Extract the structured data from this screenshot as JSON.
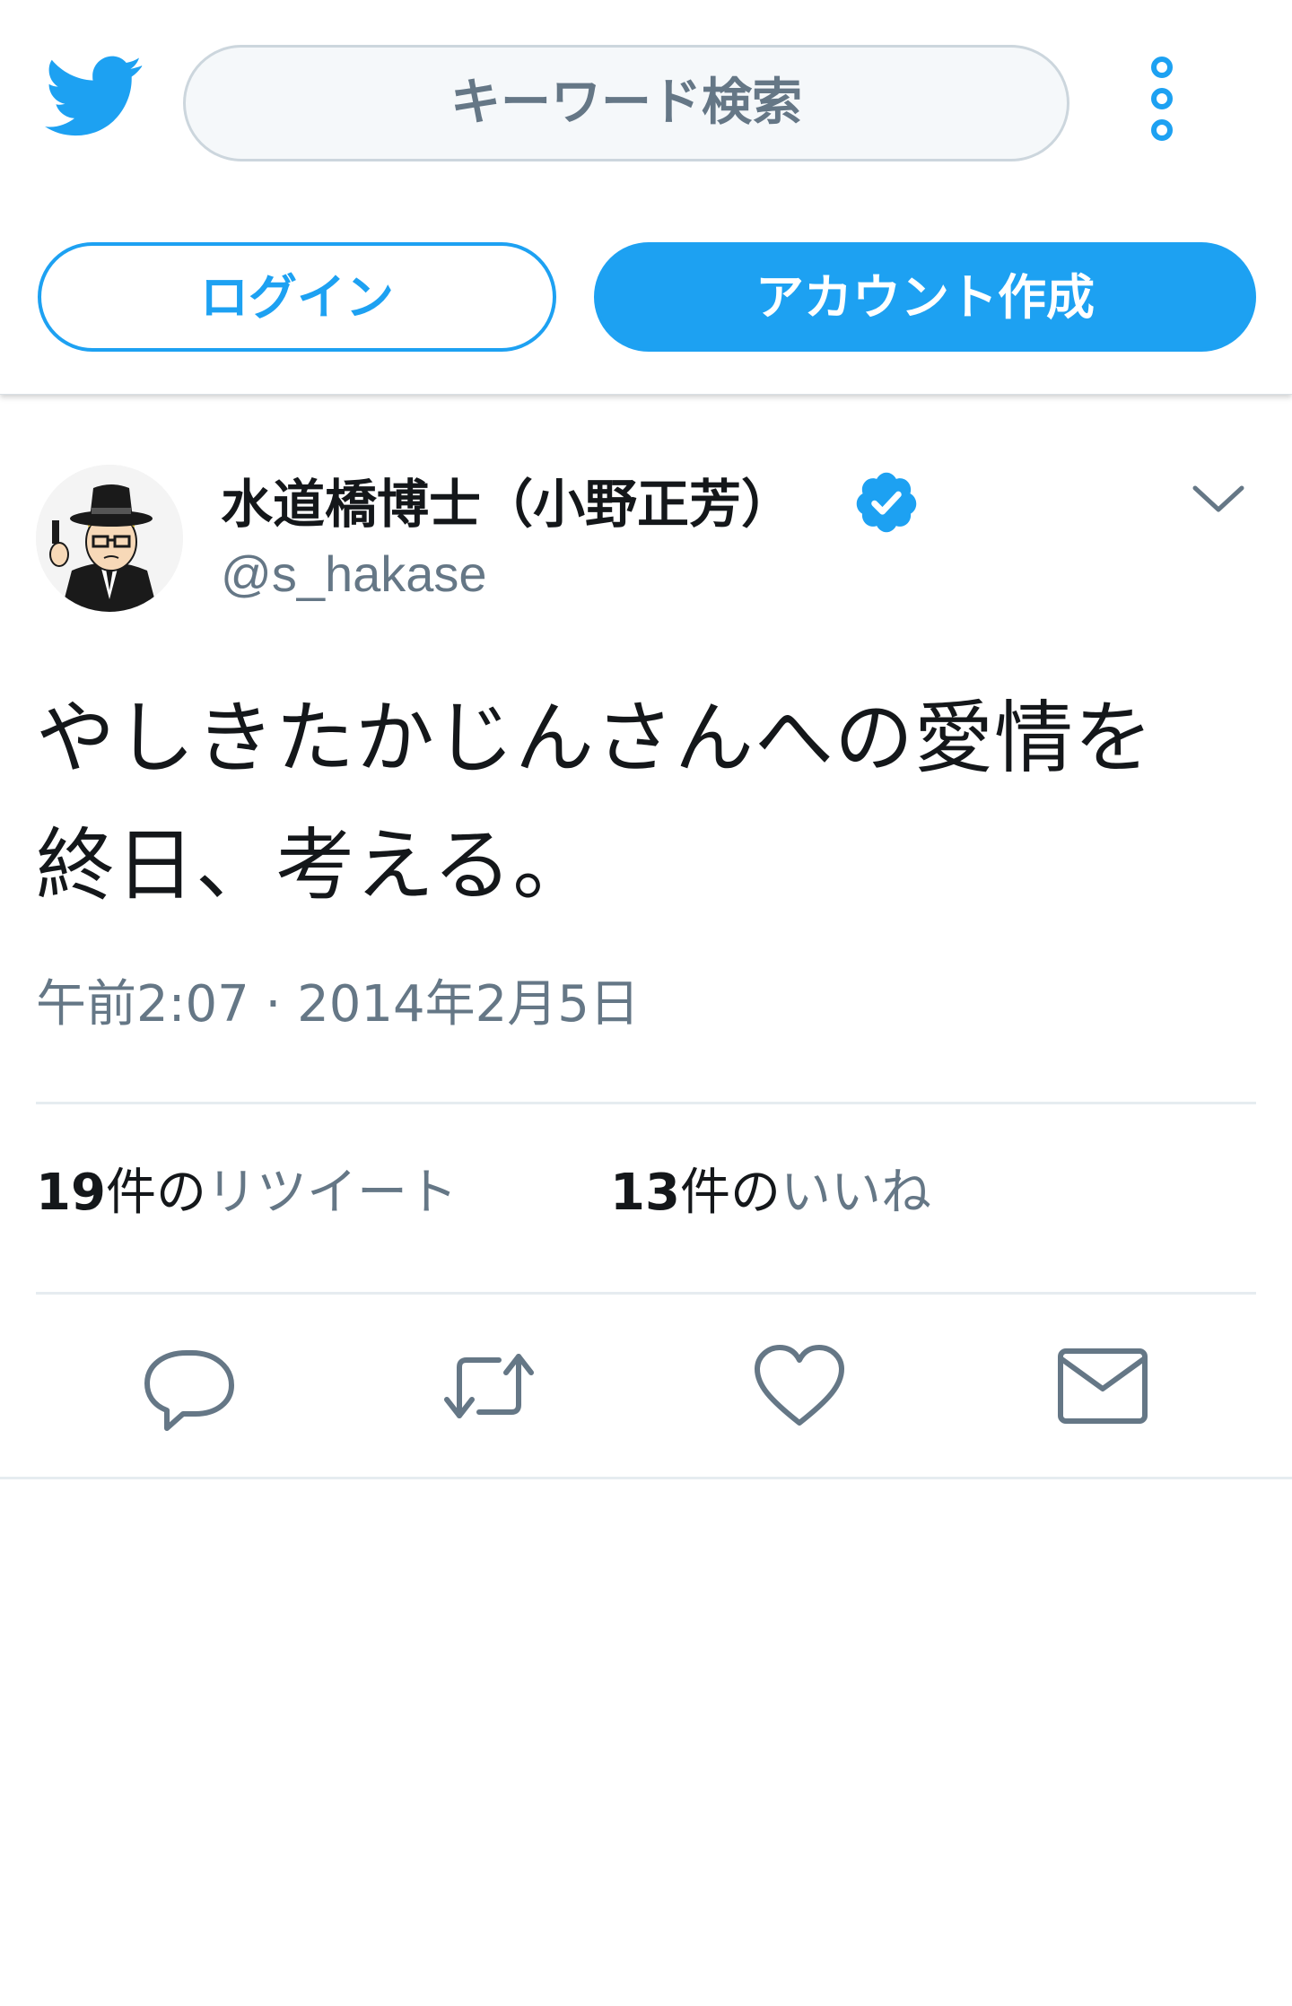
{
  "header": {
    "search_placeholder": "キーワード検索",
    "login_label": "ログイン",
    "signup_label": "アカウント作成"
  },
  "tweet": {
    "display_name": "水道橋博士（小野正芳）",
    "screen_name": "@s_hakase",
    "text_line1": "やしきたかじんさんへの愛情を",
    "text_line2": "終日、考える。",
    "timestamp": "午前2:07 · 2014年2月5日",
    "retweets": {
      "count": "19",
      "unit": "件の",
      "label": "リツイート"
    },
    "likes": {
      "count": "13",
      "unit": "件の",
      "label": "いいね"
    }
  },
  "icons": {
    "logo": "twitter-bird-icon",
    "more": "more-vertical-icon",
    "verified": "verified-badge-icon",
    "caret": "chevron-down-icon",
    "reply": "reply-icon",
    "retweet": "retweet-icon",
    "like": "heart-icon",
    "dm": "envelope-icon"
  },
  "colors": {
    "brand": "#1da1f2",
    "text": "#14171a",
    "secondary": "#657786",
    "divider": "#e6ecf0"
  }
}
